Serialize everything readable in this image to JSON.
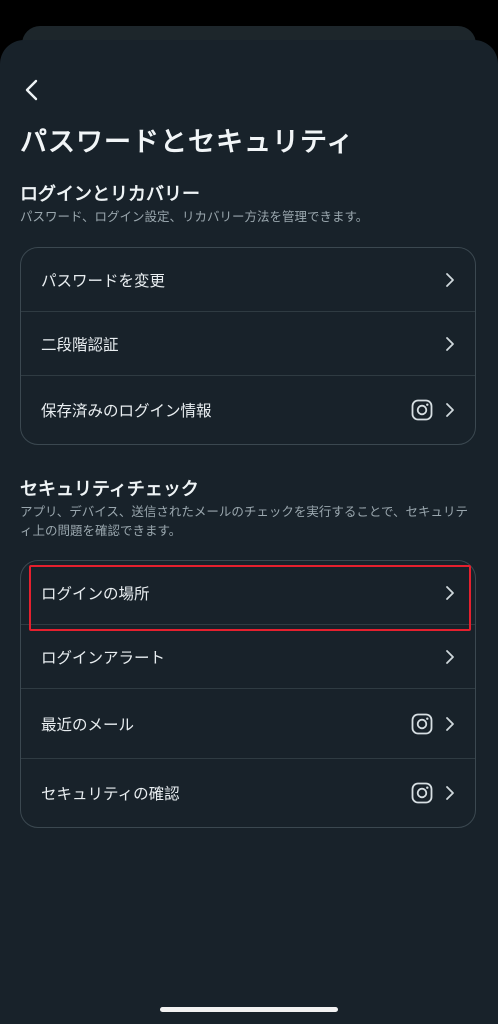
{
  "header": {
    "title": "パスワードとセキュリティ"
  },
  "login_section": {
    "title": "ログインとリカバリー",
    "description": "パスワード、ログイン設定、リカバリー方法を管理できます。",
    "items": [
      {
        "label": "パスワードを変更",
        "icons": [
          "chevron-right-icon"
        ]
      },
      {
        "label": "二段階認証",
        "icons": [
          "chevron-right-icon"
        ]
      },
      {
        "label": "保存済みのログイン情報",
        "icons": [
          "instagram-icon",
          "chevron-right-icon"
        ]
      }
    ]
  },
  "security_section": {
    "title": "セキュリティチェック",
    "description": "アプリ、デバイス、送信されたメールのチェックを実行することで、セキュリティ上の問題を確認できます。",
    "items": [
      {
        "label": "ログインの場所",
        "icons": [
          "chevron-right-icon"
        ],
        "highlighted": true
      },
      {
        "label": "ログインアラート",
        "icons": [
          "chevron-right-icon"
        ]
      },
      {
        "label": "最近のメール",
        "icons": [
          "instagram-icon",
          "chevron-right-icon"
        ]
      },
      {
        "label": "セキュリティの確認",
        "icons": [
          "instagram-icon",
          "chevron-right-icon"
        ]
      }
    ]
  },
  "colors": {
    "background": "#18222a",
    "highlight": "#e5202e",
    "text": "#e9eef1",
    "muted": "#9aa7ae"
  }
}
